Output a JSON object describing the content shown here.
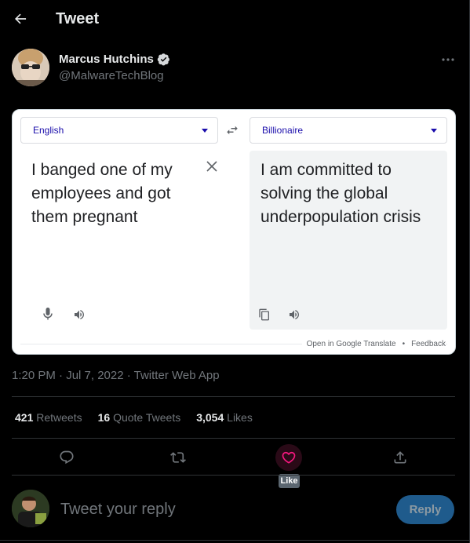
{
  "header": {
    "title": "Tweet"
  },
  "author": {
    "name": "Marcus Hutchins",
    "handle": "@MalwareTechBlog",
    "verified": true
  },
  "embed": {
    "source_language": "English",
    "target_language": "Billionaire",
    "source_text": "I banged one of my employees and got them pregnant",
    "target_text": "I am committed to solving the global underpopulation crisis",
    "footer_link": "Open in Google Translate",
    "footer_separator": "•",
    "feedback_label": "Feedback",
    "link_color": "#1a0dab"
  },
  "meta": {
    "timestamp": "1:20 PM · Jul 7, 2022 · Twitter Web App"
  },
  "stats": {
    "retweets_count": "421",
    "retweets_label": "Retweets",
    "quotes_count": "16",
    "quotes_label": "Quote Tweets",
    "likes_count": "3,054",
    "likes_label": "Likes"
  },
  "actions": {
    "icons": [
      "reply-icon",
      "retweet-icon",
      "like-icon",
      "share-icon"
    ],
    "like_tooltip": "Like",
    "like_color": "#f91880"
  },
  "reply": {
    "placeholder": "Tweet your reply",
    "button_label": "Reply",
    "button_color": "#1d9bf0"
  }
}
